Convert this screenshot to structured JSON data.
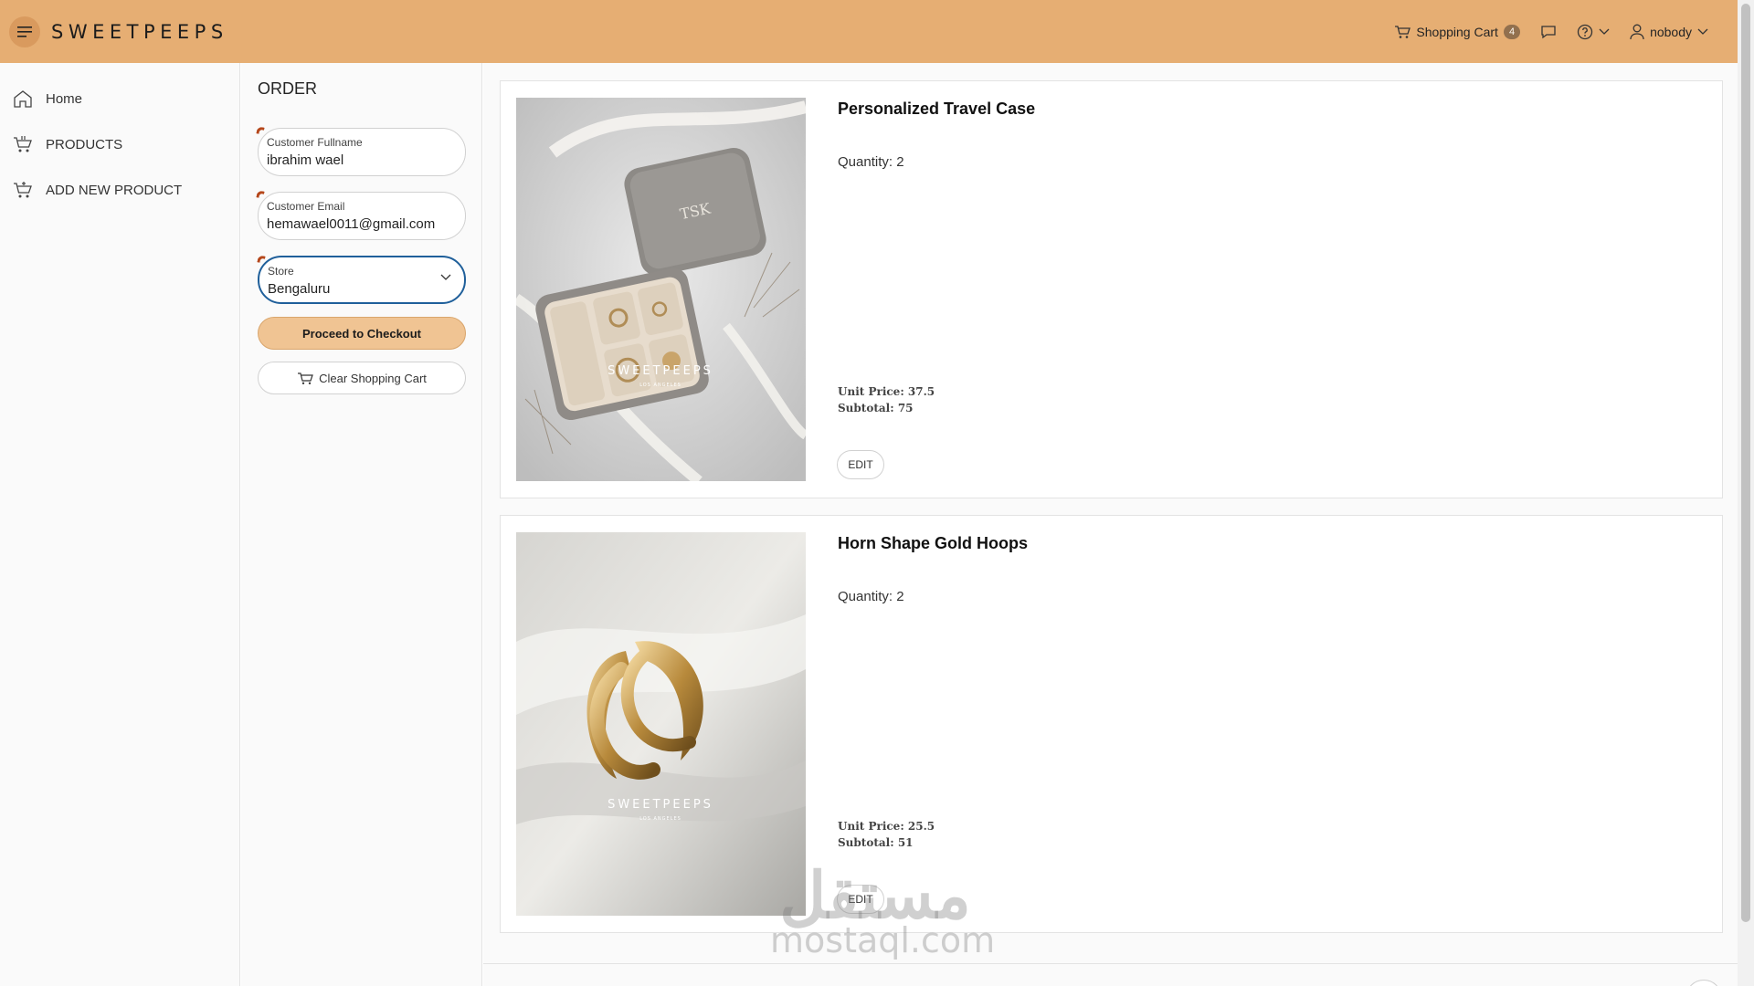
{
  "header": {
    "brand": "SWEETPEEPS",
    "cart_label": "Shopping Cart",
    "cart_count": "4",
    "user_name": "nobody"
  },
  "nav": {
    "items": [
      {
        "label": "Home",
        "icon": "home-icon"
      },
      {
        "label": "PRODUCTS",
        "icon": "cart-icon"
      },
      {
        "label": "ADD NEW PRODUCT",
        "icon": "cart-add-icon"
      }
    ]
  },
  "order": {
    "title": "ORDER",
    "fullname": {
      "label": "Customer Fullname",
      "value": "ibrahim wael"
    },
    "email": {
      "label": "Customer Email",
      "value": "hemawael0011@gmail.com"
    },
    "store": {
      "label": "Store",
      "value": "Bengaluru"
    },
    "checkout_label": "Proceed to Checkout",
    "clear_label": "Clear Shopping Cart"
  },
  "products": [
    {
      "title": "Personalized Travel Case",
      "quantity": "Quantity: 2",
      "unit_price": "Unit Price: 37.5",
      "subtotal": "Subtotal: 75",
      "edit_label": "EDIT",
      "image_brand": "SWEETPEEPS",
      "image_sub": "LOS ANGELES",
      "image_mono": "TSK"
    },
    {
      "title": "Horn Shape Gold Hoops",
      "quantity": "Quantity: 2",
      "unit_price": "Unit Price: 25.5",
      "subtotal": "Subtotal: 51",
      "edit_label": "EDIT",
      "image_brand": "SWEETPEEPS",
      "image_sub": "LOS ANGELES"
    }
  ],
  "watermark": {
    "arabic": "مستقل",
    "latin": "mostaql.com"
  },
  "colors": {
    "header_bg": "#e6ae73",
    "primary_button": "#f0c493",
    "focus_border": "#1f5f9a"
  }
}
